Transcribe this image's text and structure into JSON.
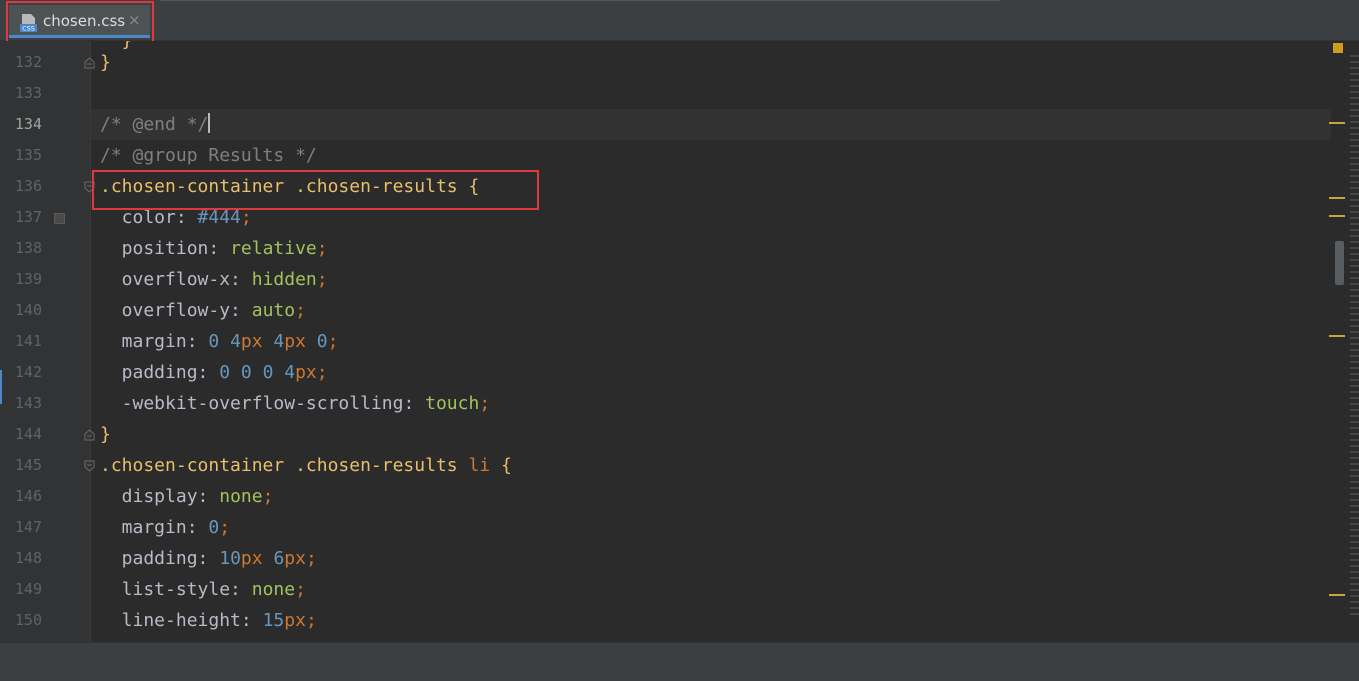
{
  "tab": {
    "label": "chosen.css",
    "icon": "css-file-icon",
    "close_label": "×"
  },
  "editor": {
    "current_line": 134,
    "top_partial": "  }",
    "lines": [
      {
        "num": "132",
        "tokens": [
          {
            "t": "}",
            "c": "t-brace"
          }
        ]
      },
      {
        "num": "133",
        "tokens": []
      },
      {
        "num": "134",
        "tokens": [
          {
            "t": "/* @end */",
            "c": "t-comment"
          }
        ]
      },
      {
        "num": "135",
        "tokens": [
          {
            "t": "/* @group Results */",
            "c": "t-comment"
          }
        ]
      },
      {
        "num": "136",
        "tokens": [
          {
            "t": ".chosen-container .chosen-results ",
            "c": "t-selector"
          },
          {
            "t": "{",
            "c": "t-brace"
          }
        ]
      },
      {
        "num": "137",
        "tokens": [
          {
            "t": "  color",
            "c": "t-prop"
          },
          {
            "t": ": ",
            "c": "t-prop"
          },
          {
            "t": "#444",
            "c": "t-color"
          },
          {
            "t": ";",
            "c": "t-punct"
          }
        ]
      },
      {
        "num": "138",
        "tokens": [
          {
            "t": "  position",
            "c": "t-prop"
          },
          {
            "t": ": ",
            "c": "t-prop"
          },
          {
            "t": "relative",
            "c": "t-value"
          },
          {
            "t": ";",
            "c": "t-punct"
          }
        ]
      },
      {
        "num": "139",
        "tokens": [
          {
            "t": "  overflow-x",
            "c": "t-prop"
          },
          {
            "t": ": ",
            "c": "t-prop"
          },
          {
            "t": "hidden",
            "c": "t-value"
          },
          {
            "t": ";",
            "c": "t-punct"
          }
        ]
      },
      {
        "num": "140",
        "tokens": [
          {
            "t": "  overflow-y",
            "c": "t-prop"
          },
          {
            "t": ": ",
            "c": "t-prop"
          },
          {
            "t": "auto",
            "c": "t-value"
          },
          {
            "t": ";",
            "c": "t-punct"
          }
        ]
      },
      {
        "num": "141",
        "tokens": [
          {
            "t": "  margin",
            "c": "t-prop"
          },
          {
            "t": ": ",
            "c": "t-prop"
          },
          {
            "t": "0 4",
            "c": "t-num"
          },
          {
            "t": "px ",
            "c": "t-unit"
          },
          {
            "t": "4",
            "c": "t-num"
          },
          {
            "t": "px ",
            "c": "t-unit"
          },
          {
            "t": "0",
            "c": "t-num"
          },
          {
            "t": ";",
            "c": "t-punct"
          }
        ]
      },
      {
        "num": "142",
        "tokens": [
          {
            "t": "  padding",
            "c": "t-prop"
          },
          {
            "t": ": ",
            "c": "t-prop"
          },
          {
            "t": "0 0 0 4",
            "c": "t-num"
          },
          {
            "t": "px",
            "c": "t-unit"
          },
          {
            "t": ";",
            "c": "t-punct"
          }
        ]
      },
      {
        "num": "143",
        "tokens": [
          {
            "t": "  -webkit-overflow-scrolling",
            "c": "t-prop"
          },
          {
            "t": ": ",
            "c": "t-prop"
          },
          {
            "t": "touch",
            "c": "t-value"
          },
          {
            "t": ";",
            "c": "t-punct"
          }
        ]
      },
      {
        "num": "144",
        "tokens": [
          {
            "t": "}",
            "c": "t-brace"
          }
        ]
      },
      {
        "num": "145",
        "tokens": [
          {
            "t": ".chosen-container .chosen-results ",
            "c": "t-selector"
          },
          {
            "t": "li ",
            "c": "t-tag"
          },
          {
            "t": "{",
            "c": "t-brace"
          }
        ]
      },
      {
        "num": "146",
        "tokens": [
          {
            "t": "  display",
            "c": "t-prop"
          },
          {
            "t": ": ",
            "c": "t-prop"
          },
          {
            "t": "none",
            "c": "t-value"
          },
          {
            "t": ";",
            "c": "t-punct"
          }
        ]
      },
      {
        "num": "147",
        "tokens": [
          {
            "t": "  margin",
            "c": "t-prop"
          },
          {
            "t": ": ",
            "c": "t-prop"
          },
          {
            "t": "0",
            "c": "t-num"
          },
          {
            "t": ";",
            "c": "t-punct"
          }
        ]
      },
      {
        "num": "148",
        "tokens": [
          {
            "t": "  padding",
            "c": "t-prop"
          },
          {
            "t": ": ",
            "c": "t-prop"
          },
          {
            "t": "10",
            "c": "t-num"
          },
          {
            "t": "px ",
            "c": "t-unit"
          },
          {
            "t": "6",
            "c": "t-num"
          },
          {
            "t": "px",
            "c": "t-unit"
          },
          {
            "t": ";",
            "c": "t-punct"
          }
        ]
      },
      {
        "num": "149",
        "tokens": [
          {
            "t": "  list-style",
            "c": "t-prop"
          },
          {
            "t": ": ",
            "c": "t-prop"
          },
          {
            "t": "none",
            "c": "t-value"
          },
          {
            "t": ";",
            "c": "t-punct"
          }
        ]
      },
      {
        "num": "150",
        "tokens": [
          {
            "t": "  line-height",
            "c": "t-prop"
          },
          {
            "t": ": ",
            "c": "t-prop"
          },
          {
            "t": "15",
            "c": "t-num"
          },
          {
            "t": "px",
            "c": "t-unit"
          },
          {
            "t": ";",
            "c": "t-punct"
          }
        ]
      }
    ]
  },
  "colors": {
    "highlight": "#e0383e",
    "accent": "#4a88c7",
    "warning": "#cc9b1f"
  }
}
